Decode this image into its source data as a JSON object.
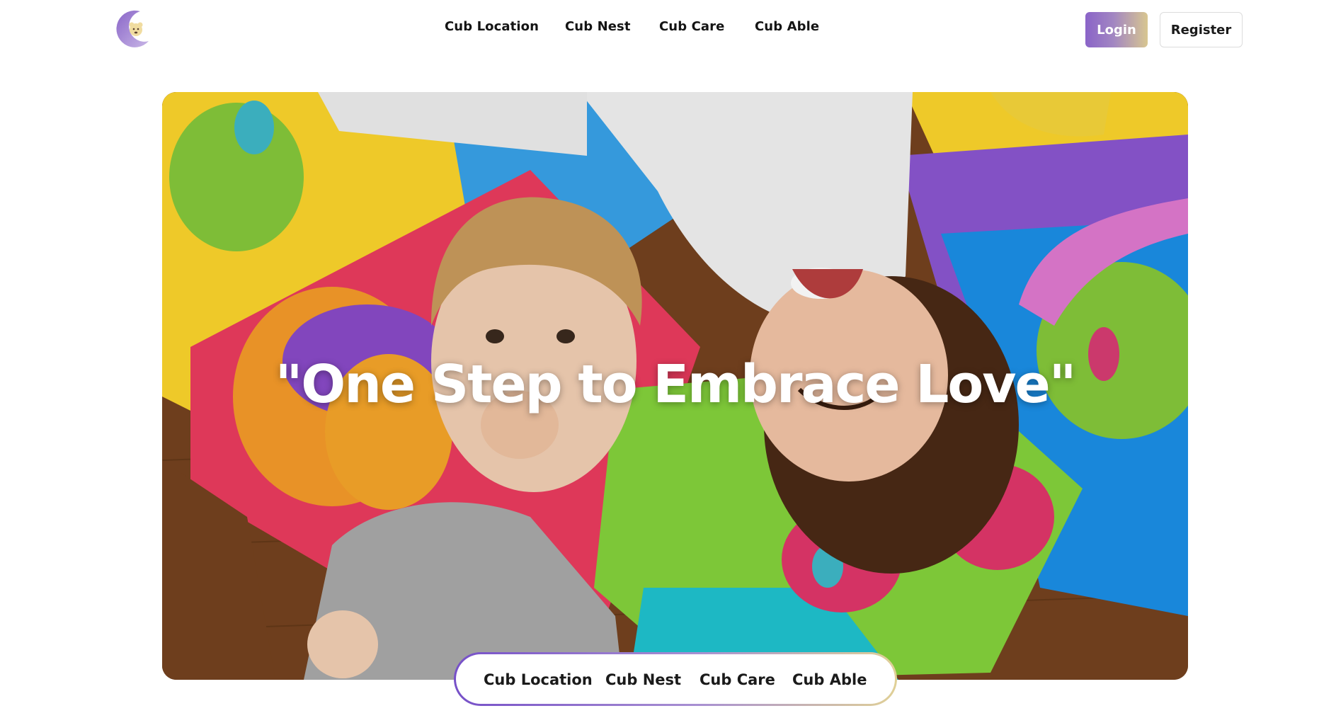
{
  "header": {
    "logo_icon": "moon-bear-logo",
    "nav": [
      "Cub Location",
      "Cub Nest",
      "Cub Care",
      "Cub Able"
    ],
    "login_label": "Login",
    "register_label": "Register"
  },
  "hero": {
    "image": "two-children-lying-on-colorful-foam-puzzle-mat",
    "headline": "\"One Step to Embrace Love\""
  },
  "pill_nav": [
    "Cub Location",
    "Cub Nest",
    "Cub Care",
    "Cub Able"
  ],
  "colors": {
    "accent_purple": "#7650c8",
    "accent_gold": "#e0d096",
    "text": "#141414"
  }
}
